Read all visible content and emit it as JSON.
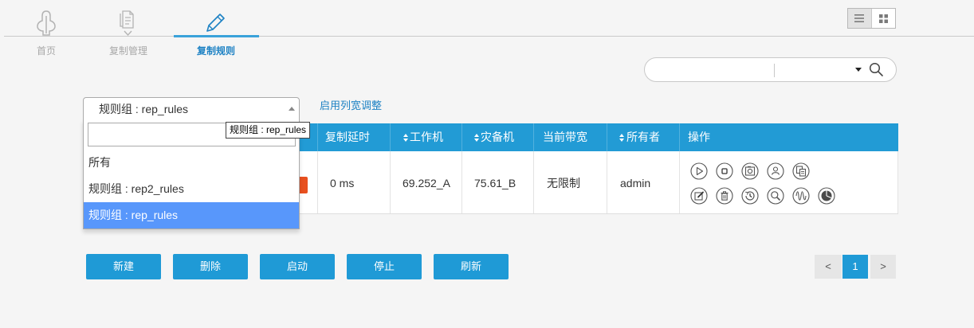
{
  "nav": {
    "items": [
      {
        "label": "首页",
        "icon": "home-icon",
        "active": false
      },
      {
        "label": "复制管理",
        "icon": "replication-management-icon",
        "active": false
      },
      {
        "label": "复制规则",
        "icon": "pencil-icon",
        "active": true
      }
    ]
  },
  "view_toggle": [
    {
      "icon": "list-view-icon",
      "active": true
    },
    {
      "icon": "grid-view-icon",
      "active": false
    }
  ],
  "search": {
    "value": "",
    "filter_value": "",
    "icons": [
      "chevron-down-icon",
      "search-icon"
    ]
  },
  "rule_group": {
    "selected": "规则组 : rep_rules",
    "search_value": "",
    "tooltip": "规则组 : rep_rules",
    "options": [
      {
        "label": "所有",
        "highlighted": false
      },
      {
        "label": "规则组 : rep2_rules",
        "highlighted": false
      },
      {
        "label": "规则组 : rep_rules",
        "highlighted": true
      }
    ]
  },
  "column_resize_link": "启用列宽调整",
  "table": {
    "headers": [
      {
        "label": "复制延时",
        "sortable": false
      },
      {
        "label": "工作机",
        "sortable": true
      },
      {
        "label": "灾备机",
        "sortable": true
      },
      {
        "label": "当前带宽",
        "sortable": false
      },
      {
        "label": "所有者",
        "sortable": true
      },
      {
        "label": "操作",
        "sortable": false
      }
    ],
    "rows": [
      {
        "status_color": "#e8501f",
        "replication_delay": "0 ms",
        "work_machine": "69.252_A",
        "backup_machine": "75.61_B",
        "bandwidth": "无限制",
        "owner": "admin",
        "operations": [
          "start-icon",
          "stop-icon",
          "snapshot-icon",
          "owner-icon",
          "copy-icon",
          "edit-icon",
          "delete-icon",
          "history-icon",
          "search-icon",
          "waveform-icon",
          "statistics-icon"
        ]
      }
    ]
  },
  "actions": [
    "新建",
    "删除",
    "启动",
    "停止",
    "刷新"
  ],
  "pagination": {
    "prev": "<",
    "current": "1",
    "next": ">"
  },
  "colors": {
    "primary": "#1f9ad6",
    "table_header": "#229bd5",
    "active_nav": "#1e82c4",
    "option_highlight": "#5897fb",
    "status": "#e8501f",
    "background": "#f5f5f5"
  }
}
